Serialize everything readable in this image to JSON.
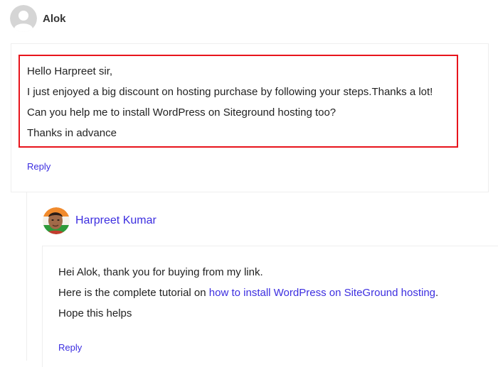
{
  "comments": [
    {
      "author": "Alok",
      "avatar_icon": "default-user-avatar-icon",
      "lines": [
        "Hello Harpreet sir,",
        "I just enjoyed a big discount on hosting purchase by following your steps.Thanks a lot!",
        "Can you help me to install WordPress on Siteground hosting too?",
        "Thanks in advance"
      ],
      "reply_label": "Reply"
    },
    {
      "author": "Harpreet Kumar",
      "avatar_icon": "profile-photo-avatar",
      "lines": [
        "Hei Alok, thank you for buying from my link.",
        "Here is the complete tutorial on ",
        "Hope this helps"
      ],
      "link_text": "how to install WordPress on SiteGround hosting",
      "link_suffix": ".",
      "reply_label": "Reply"
    }
  ],
  "colors": {
    "link": "#3c2ee0",
    "highlight_border": "#e8141c",
    "box_border": "#eeeeee"
  }
}
